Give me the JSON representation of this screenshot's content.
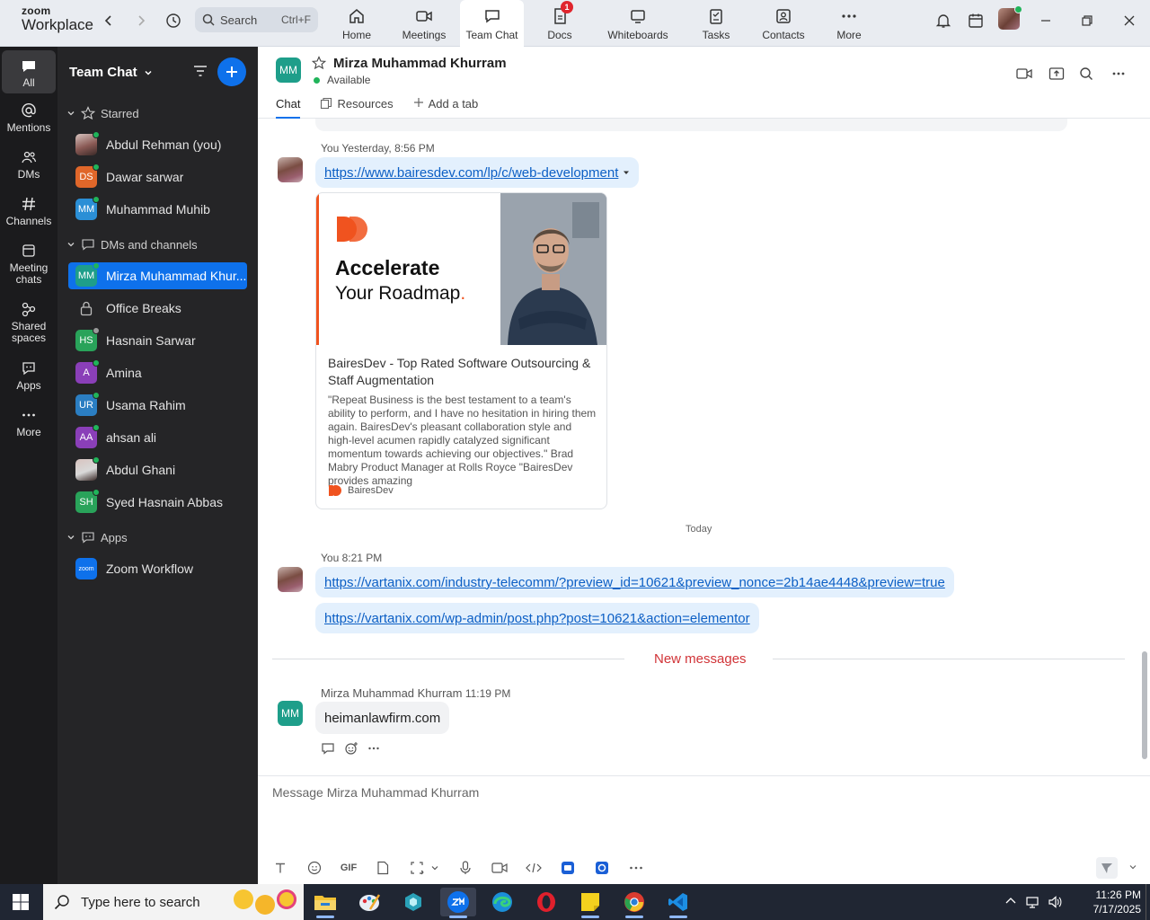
{
  "topbar": {
    "brand_top": "zoom",
    "brand_bottom": "Workplace",
    "search_label": "Search",
    "search_shortcut": "Ctrl+F",
    "nav": [
      {
        "label": "Home",
        "icon": "home-icon"
      },
      {
        "label": "Meetings",
        "icon": "video-camera-icon"
      },
      {
        "label": "Team Chat",
        "icon": "chat-bubble-icon",
        "active": true
      },
      {
        "label": "Docs",
        "icon": "document-icon",
        "badge": "1"
      },
      {
        "label": "Whiteboards",
        "icon": "whiteboard-icon"
      },
      {
        "label": "Tasks",
        "icon": "tasks-icon"
      },
      {
        "label": "Contacts",
        "icon": "contacts-icon"
      },
      {
        "label": "More",
        "icon": "more-dots-icon"
      }
    ]
  },
  "rail": [
    {
      "label": "All",
      "icon": "chat-icon",
      "active": true
    },
    {
      "label": "Mentions",
      "icon": "at-icon"
    },
    {
      "label": "DMs",
      "icon": "people-icon"
    },
    {
      "label": "Channels",
      "icon": "hash-icon"
    },
    {
      "label": "Meeting chats",
      "icon": "calendar-icon"
    },
    {
      "label": "Shared spaces",
      "icon": "shared-icon"
    },
    {
      "label": "Apps",
      "icon": "apps-icon"
    },
    {
      "label": "More",
      "icon": "more-dots-icon"
    }
  ],
  "sidebar": {
    "title": "Team Chat",
    "sections": {
      "starred": "Starred",
      "dms": "DMs and channels",
      "apps": "Apps"
    },
    "starred": [
      {
        "name": "Abdul Rehman (you)",
        "initials": "",
        "color": "#8a5a55",
        "photo": true,
        "online": true
      },
      {
        "name": "Dawar sarwar",
        "initials": "DS",
        "color": "#e0672a",
        "online": true
      },
      {
        "name": "Muhammad Muhib",
        "initials": "MM",
        "color": "#2b8fd6",
        "online": true
      }
    ],
    "dms": [
      {
        "name": "Mirza Muhammad Khur...",
        "initials": "MM",
        "color": "#1e9e8a",
        "online": true,
        "selected": true
      },
      {
        "name": "Office Breaks",
        "initials": "",
        "lock": true
      },
      {
        "name": "Hasnain Sarwar",
        "initials": "HS",
        "color": "#29a35a",
        "online": false
      },
      {
        "name": "Amina",
        "initials": "A",
        "color": "#8a3fb8",
        "online": true
      },
      {
        "name": "Usama Rahim",
        "initials": "UR",
        "color": "#2b7ec2",
        "online": true
      },
      {
        "name": "ahsan ali",
        "initials": "AA",
        "color": "#8a3fb8",
        "online": true
      },
      {
        "name": "Abdul Ghani",
        "initials": "",
        "color": "#d9d9d9",
        "photo": true,
        "online": true
      },
      {
        "name": "Syed Hasnain Abbas",
        "initials": "SH",
        "color": "#29a35a",
        "online": true
      }
    ],
    "apps": [
      {
        "name": "Zoom Workflow",
        "initials": "zoom",
        "color": "#0e71eb"
      }
    ]
  },
  "chat": {
    "contact_initials": "MM",
    "contact_name": "Mirza Muhammad Khurram",
    "status": "Available",
    "tabs": [
      "Chat",
      "Resources",
      "Add a tab"
    ]
  },
  "messages": {
    "msg1_sender": "You",
    "msg1_time": "Yesterday, 8:56 PM",
    "msg1_link": "https://www.bairesdev.com/lp/c/web-development",
    "card_headline_1": "Accelerate",
    "card_headline_2": "Your Roadmap",
    "card_headline_dot": ".",
    "card_title": "BairesDev - Top Rated Software Outsourcing & Staff Augmentation",
    "card_desc": "\"Repeat Business is the best testament to a team's ability to perform, and I have no hesitation in hiring them again. BairesDev's pleasant collaboration style and high-level acumen rapidly catalyzed significant momentum towards achieving our objectives.\" Brad Mabry Product Manager at Rolls Royce \"BairesDev provides amazing",
    "card_source": "BairesDev",
    "day_separator": "Today",
    "msg2_sender": "You",
    "msg2_time": "8:21 PM",
    "msg2_link1": "https://vartanix.com/industry-telecomm/?preview_id=10621&preview_nonce=2b14ae4448&preview=true",
    "msg2_link2": "https://vartanix.com/wp-admin/post.php?post=10621&action=elementor",
    "new_messages": "New messages",
    "msg3_sender": "Mirza Muhammad Khurram",
    "msg3_time": "11:19 PM",
    "msg3_initials": "MM",
    "msg3_text": "heimanlawfirm.com"
  },
  "composer": {
    "placeholder": "Message Mirza Muhammad Khurram",
    "gif_label": "GIF"
  },
  "taskbar": {
    "search_placeholder": "Type here to search",
    "time": "11:26 PM",
    "date": "7/17/2025"
  }
}
